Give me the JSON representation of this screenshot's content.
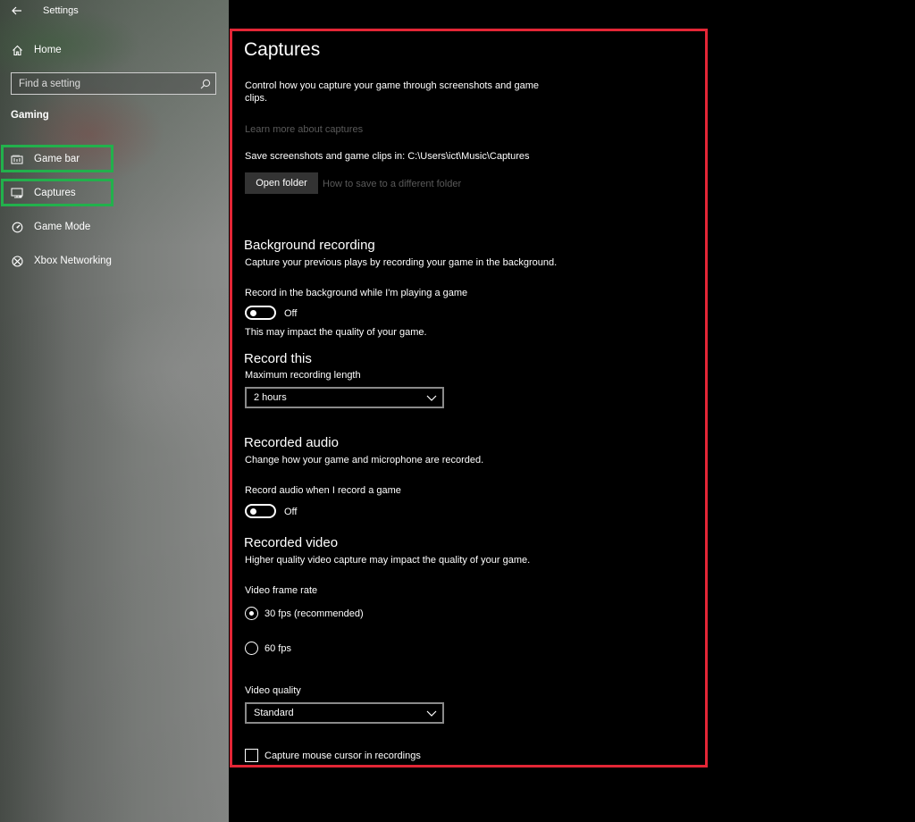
{
  "window": {
    "title": "Settings"
  },
  "sidebar": {
    "home_label": "Home",
    "search_placeholder": "Find a setting",
    "section": "Gaming",
    "items": [
      {
        "label": "Game bar",
        "icon": "game-bar-icon"
      },
      {
        "label": "Captures",
        "icon": "captures-icon"
      },
      {
        "label": "Game Mode",
        "icon": "game-mode-icon"
      },
      {
        "label": "Xbox Networking",
        "icon": "xbox-icon"
      }
    ]
  },
  "main": {
    "title": "Captures",
    "intro_line1": "Control how you capture your game through screenshots and game",
    "intro_line2": "clips.",
    "learn_more": "Learn more about captures",
    "save_path": "Save screenshots and game clips in: C:\\Users\\ict\\Music\\Captures",
    "open_folder": "Open folder",
    "how_to_save": "How to save to a different folder",
    "background": {
      "heading": "Background recording",
      "description": "Capture your previous plays by recording your game in the background.",
      "toggle_label": "Record in the background while I'm playing a game",
      "toggle_state": "Off",
      "note": "This may impact the quality of your game."
    },
    "record_this": {
      "heading": "Record this",
      "label": "Maximum recording length",
      "value": "2 hours"
    },
    "audio": {
      "heading": "Recorded audio",
      "description": "Change how your game and microphone are recorded.",
      "toggle_label": "Record audio when I record a game",
      "toggle_state": "Off"
    },
    "video": {
      "heading": "Recorded video",
      "description": "Higher quality video capture may impact the quality of your game.",
      "frame_rate_label": "Video frame rate",
      "option_30": "30 fps (recommended)",
      "option_60": "60 fps",
      "quality_label": "Video quality",
      "quality_value": "Standard",
      "cursor_checkbox": "Capture mouse cursor in recordings"
    }
  },
  "colors": {
    "highlight_green": "#22b14c",
    "highlight_red": "#e32636",
    "dim_text": "#5a5a5a"
  }
}
